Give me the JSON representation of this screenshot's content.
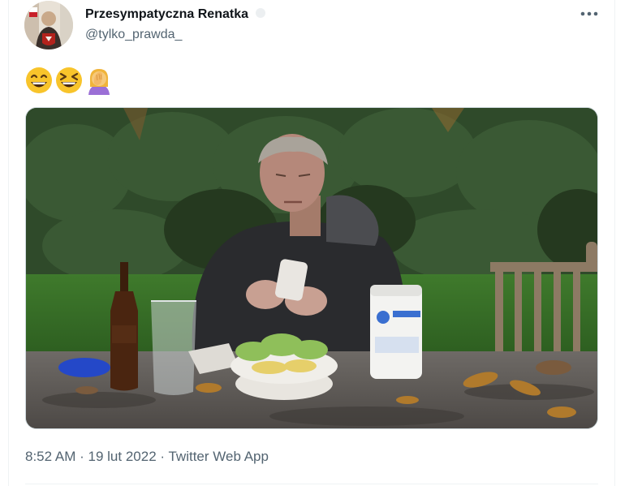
{
  "author": {
    "display_name": "Przesympatyczna Renatka",
    "handle": "@tylko_prawda_"
  },
  "tweet": {
    "emojis": [
      "grinning-face-with-smiling-eyes",
      "grinning-squinting-face",
      "woman-facepalming"
    ],
    "media_type": "video"
  },
  "meta": {
    "time": "8:52 AM",
    "separator": "·",
    "date": "19 lut 2022",
    "source": "Twitter Web App"
  },
  "colors": {
    "text_primary": "#0f1419",
    "text_secondary": "#536471",
    "border": "#cfd9de",
    "divider": "#eff3f4"
  }
}
